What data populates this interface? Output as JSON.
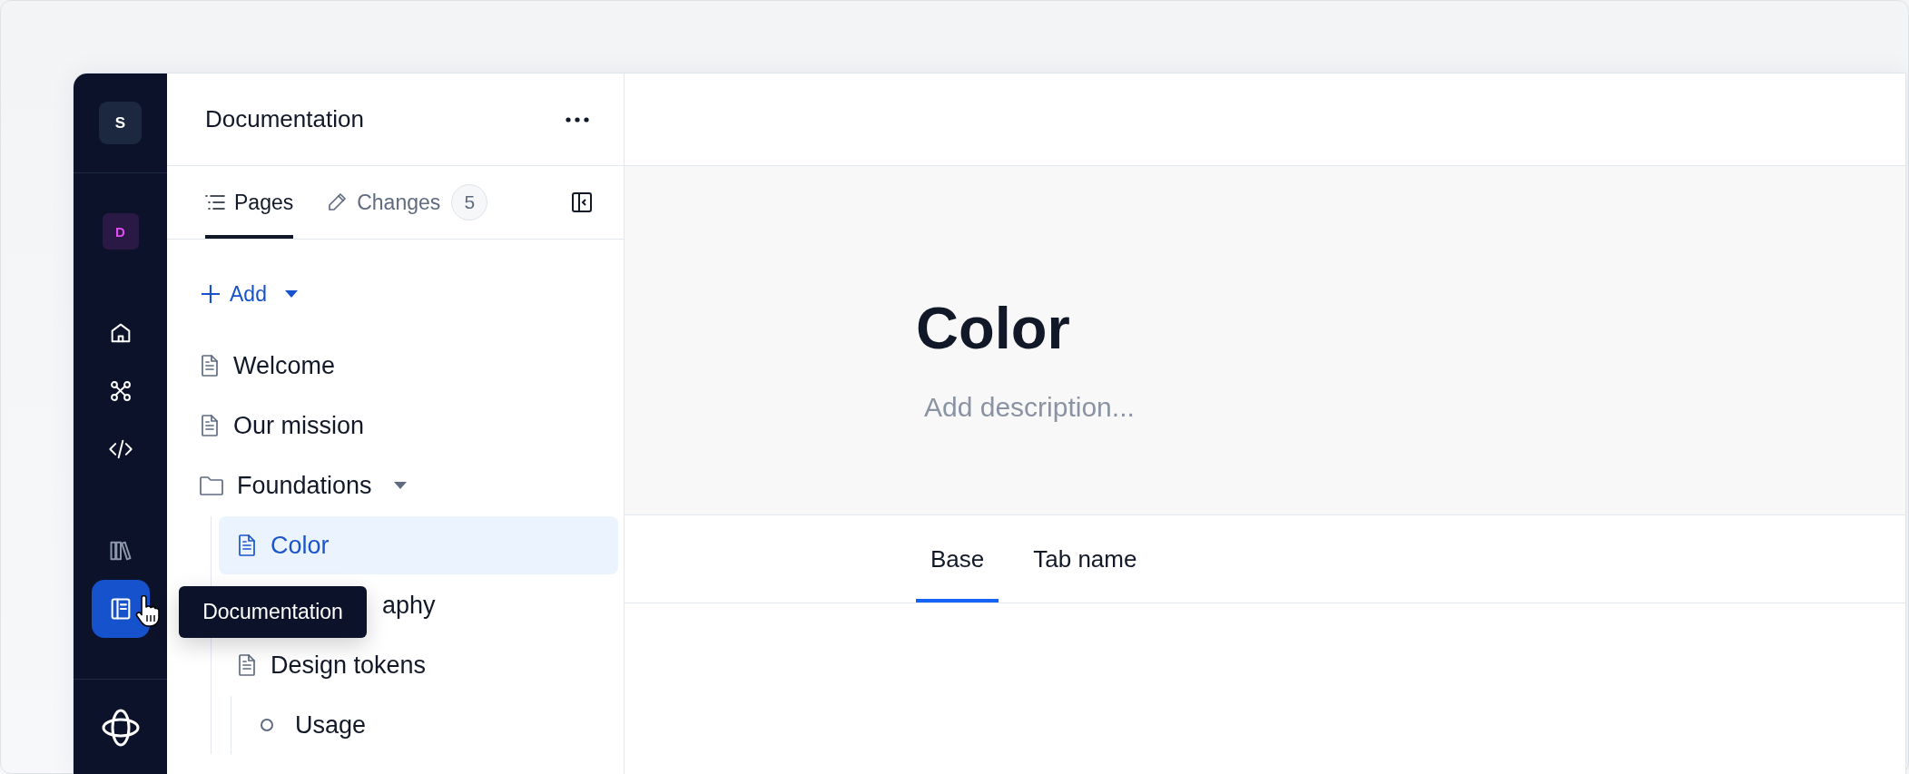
{
  "rail": {
    "workspace": "S",
    "project": "D",
    "nav": [
      {
        "kind": "home",
        "selected": false
      },
      {
        "kind": "nodes",
        "selected": false
      },
      {
        "kind": "code",
        "selected": false
      }
    ],
    "tools": [
      {
        "kind": "library",
        "selected": false
      },
      {
        "kind": "docs",
        "selected": true
      }
    ]
  },
  "tooltip": "Documentation",
  "sidebar": {
    "title": "Documentation",
    "tabs": [
      {
        "kind": "pages",
        "label": "Pages",
        "selected": true
      },
      {
        "kind": "changes",
        "label": "Changes",
        "count": "5",
        "selected": false
      }
    ],
    "add": "Add",
    "tree": [
      {
        "kind": "page",
        "label": "Welcome",
        "selected": false
      },
      {
        "kind": "page",
        "label": "Our mission",
        "selected": false
      },
      {
        "kind": "folder",
        "label": "Foundations",
        "selected": false,
        "expanded": true,
        "children": [
          {
            "kind": "page",
            "label": "Color",
            "selected": true
          },
          {
            "kind": "page",
            "label": "aphy",
            "selected": false,
            "covered": true
          },
          {
            "kind": "page",
            "label": "Design tokens",
            "selected": false,
            "children": [
              {
                "kind": "sub",
                "label": "Usage",
                "selected": false
              }
            ]
          }
        ]
      }
    ]
  },
  "main": {
    "title": "Color",
    "description_placeholder": "Add description...",
    "tabs": [
      {
        "label": "Base",
        "selected": true
      },
      {
        "label": "Tab name",
        "selected": false
      }
    ]
  }
}
